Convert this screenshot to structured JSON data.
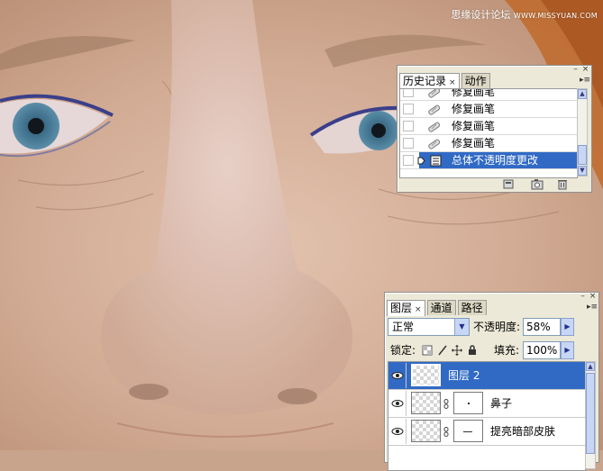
{
  "watermark": {
    "site_name": "思缘设计论坛",
    "site_url": "WWW.MISSYUAN.COM"
  },
  "colors": {
    "selection_blue": "#316ac5",
    "panel_bg": "#ece9d8"
  },
  "history_panel": {
    "tabs": [
      {
        "label": "历史记录",
        "active": true
      },
      {
        "label": "动作",
        "active": false
      }
    ],
    "items": [
      {
        "label": "修复画笔",
        "icon": "healing-brush-icon",
        "selected": false
      },
      {
        "label": "修复画笔",
        "icon": "healing-brush-icon",
        "selected": false
      },
      {
        "label": "修复画笔",
        "icon": "healing-brush-icon",
        "selected": false
      },
      {
        "label": "修复画笔",
        "icon": "healing-brush-icon",
        "selected": false
      },
      {
        "label": "总体不透明度更改",
        "icon": "layer-icon",
        "selected": true
      }
    ],
    "footer_icons": [
      "new-document-from-state-icon",
      "camera-snapshot-icon",
      "trash-icon"
    ]
  },
  "layers_panel": {
    "tabs": [
      {
        "label": "图层",
        "active": true
      },
      {
        "label": "通道",
        "active": false
      },
      {
        "label": "路径",
        "active": false
      }
    ],
    "blend_mode": "正常",
    "opacity_label": "不透明度:",
    "opacity_value": "58%",
    "lock_label": "锁定:",
    "lock_icons": [
      "lock-transparent-icon",
      "lock-brush-icon",
      "lock-move-icon",
      "lock-all-icon"
    ],
    "fill_label": "填充:",
    "fill_value": "100%",
    "layers": [
      {
        "name": "图层 2",
        "visible": true,
        "selected": true,
        "has_mask": false
      },
      {
        "name": "鼻子",
        "visible": true,
        "selected": false,
        "has_mask": true
      },
      {
        "name": "提亮暗部皮肤",
        "visible": true,
        "selected": false,
        "has_mask": true
      }
    ]
  }
}
